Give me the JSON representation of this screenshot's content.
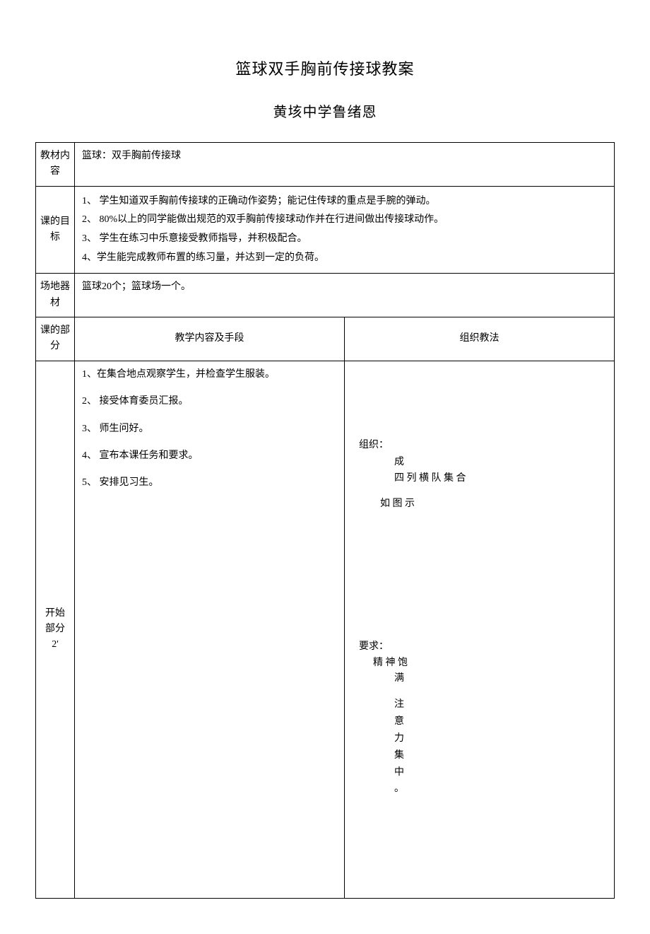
{
  "title": "篮球双手胸前传接球教案",
  "subtitle": "黄垓中学鲁绪恩",
  "rows": {
    "material": {
      "label": "教材内容",
      "content": "篮球：双手胸前传接球"
    },
    "goals": {
      "label": "课的目标",
      "items": [
        "1、 学生知道双手胸前传接球的正确动作姿势；能记住传球的重点是手腕的弹动。",
        "2、 80%以上的同学能做出规范的双手胸前传接球动作并在行进间做出传接球动作。",
        "3、 学生在练习中乐意接受教师指导，并积极配合。",
        "4、学生能完成教师布置的练习量，并达到一定的负荷。"
      ]
    },
    "equipment": {
      "label": "场地器材",
      "content": "篮球20个；篮球场一个。"
    },
    "section_header": {
      "label": "课的部分",
      "mid": "教学内容及手段",
      "right": "组织教法"
    },
    "start_section": {
      "label_line1": "开始",
      "label_line2": "部分",
      "label_line3": "2'",
      "content_items": [
        "1、在集合地点观察学生，并检查学生服装。",
        "2、 接受体育委员汇报。",
        "3、 师生问好。",
        "4、 宣布本课任务和要求。",
        "5、 安排见习生。"
      ],
      "org": {
        "label": "组织：",
        "line1": "成",
        "line2": "四 列 横 队 集 合",
        "line3": "如 图 示"
      },
      "req": {
        "label": "要求：",
        "line1a": "精 神 饱",
        "line1b": "满",
        "vertical": [
          "注",
          "意",
          "力",
          "集",
          "中",
          "。"
        ]
      }
    }
  }
}
